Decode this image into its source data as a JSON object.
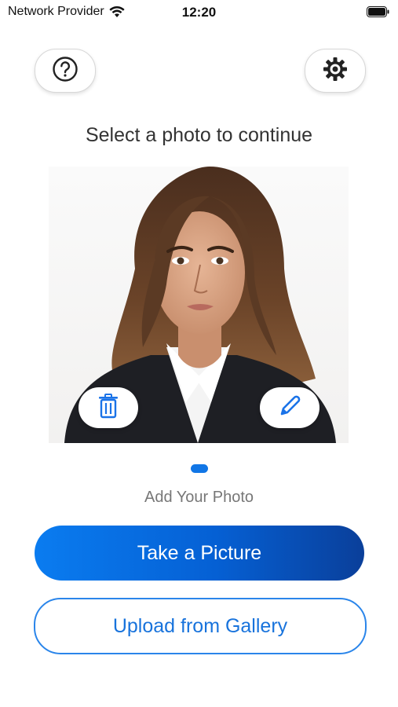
{
  "status_bar": {
    "carrier": "Network Provider",
    "time": "12:20",
    "wifi_icon": "wifi-icon",
    "battery_icon": "battery-icon"
  },
  "toolbar": {
    "help_icon": "question-circle-icon",
    "settings_icon": "gear-icon"
  },
  "main": {
    "prompt": "Select a photo to continue",
    "photo_actions": {
      "delete_icon": "trash-icon",
      "edit_icon": "pencil-icon"
    },
    "page_indicator": {
      "current": 1,
      "total": 1
    },
    "caption": "Add Your Photo",
    "primary_button": "Take a Picture",
    "secondary_button": "Upload from Gallery"
  },
  "colors": {
    "accent": "#0a7cf0",
    "accent_dark": "#0a3f9a",
    "outline": "#2a85ea"
  }
}
